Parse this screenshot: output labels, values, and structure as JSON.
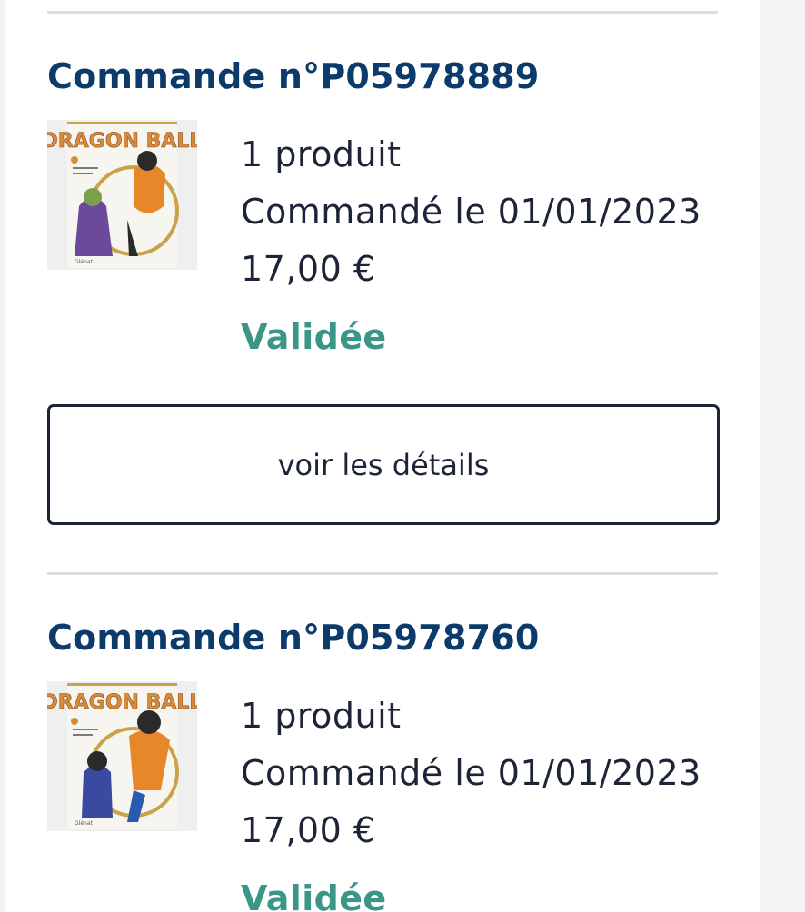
{
  "orders": [
    {
      "title": "Commande n°P05978889",
      "cover_icon": "dragon-ball-book-cover",
      "product_count": "1 produit",
      "ordered_on": "Commandé le 01/01/2023",
      "price": "17,00 €",
      "status": "Validée",
      "details_label": "voir les détails"
    },
    {
      "title": "Commande n°P05978760",
      "cover_icon": "dragon-ball-book-cover",
      "product_count": "1 produit",
      "ordered_on": "Commandé le 01/01/2023",
      "price": "17,00 €",
      "status": "Validée"
    }
  ],
  "colors": {
    "title": "#0b3a6b",
    "status": "#3b9688",
    "text": "#1e2438",
    "divider": "#dcdde2"
  }
}
